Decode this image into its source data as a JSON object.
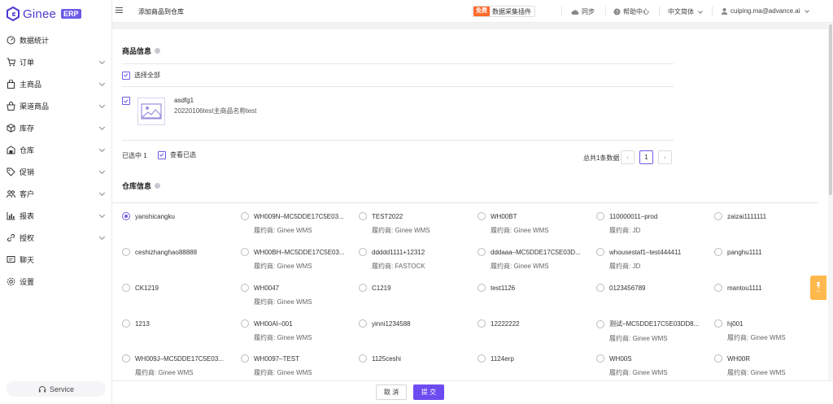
{
  "app": {
    "logo_text": "Ginee",
    "logo_badge": "ERP"
  },
  "sidebar": {
    "items": [
      {
        "label": "数据统计",
        "icon": "dashboard-icon",
        "has_children": false
      },
      {
        "label": "订单",
        "icon": "cart-icon",
        "has_children": true
      },
      {
        "label": "主商品",
        "icon": "bag-icon",
        "has_children": true
      },
      {
        "label": "渠道商品",
        "icon": "store-bag-icon",
        "has_children": true
      },
      {
        "label": "库存",
        "icon": "box-icon",
        "has_children": true
      },
      {
        "label": "仓库",
        "icon": "warehouse-icon",
        "has_children": true
      },
      {
        "label": "促销",
        "icon": "tag-icon",
        "has_children": true
      },
      {
        "label": "客户",
        "icon": "users-icon",
        "has_children": true
      },
      {
        "label": "报表",
        "icon": "bar-chart-icon",
        "has_children": true
      },
      {
        "label": "授权",
        "icon": "link-icon",
        "has_children": true
      },
      {
        "label": "聊天",
        "icon": "chat-icon",
        "has_children": false
      },
      {
        "label": "设置",
        "icon": "gear-icon",
        "has_children": false
      }
    ],
    "service_label": "Service"
  },
  "topbar": {
    "breadcrumb": "添加商品到仓库",
    "plugin_badge": "免费",
    "plugin_label": "数据采集插件",
    "sync": "同步",
    "help": "帮助中心",
    "language": "中文简体",
    "user": "cuiping.ma@advance.ai"
  },
  "product_section": {
    "title": "商品信息",
    "select_all": "选择全部",
    "product": {
      "name": "asdfg1",
      "subtitle": "20220106test主商品名称test"
    },
    "selected_count": "已选中 1",
    "view_selected": "查看已选",
    "total": "总共1条数据",
    "page": "1"
  },
  "warehouse_section": {
    "title": "仓库信息",
    "rows": [
      [
        {
          "name": "yanshicangku",
          "selected": true,
          "provider": ""
        },
        {
          "name": "WH009N–MC5DDE17C5E03...",
          "selected": false,
          "provider": "履约商:  Ginee WMS"
        },
        {
          "name": "TEST2022",
          "selected": false,
          "provider": "履约商:  Ginee WMS"
        },
        {
          "name": "WH00BT",
          "selected": false,
          "provider": "履约商:  Ginee WMS"
        },
        {
          "name": "110000011–prod",
          "selected": false,
          "provider": "履约商:  JD"
        },
        {
          "name": "zaizai1111111",
          "selected": false,
          "provider": ""
        }
      ],
      [
        {
          "name": "ceshizhanghao88888",
          "selected": false,
          "provider": ""
        },
        {
          "name": "WH00BH–MC5DDE17C5E03...",
          "selected": false,
          "provider": "履约商:  Ginee WMS"
        },
        {
          "name": "ddddd1111+12312",
          "selected": false,
          "provider": "履约商:  FASTOCK"
        },
        {
          "name": "dddaaa–MC5DDE17C5E03D...",
          "selected": false,
          "provider": "履约商:  Ginee WMS"
        },
        {
          "name": "whousestaf1–test444411",
          "selected": false,
          "provider": "履约商:  JD"
        },
        {
          "name": "panghu1111",
          "selected": false,
          "provider": ""
        }
      ],
      [
        {
          "name": "CK1219",
          "selected": false,
          "provider": ""
        },
        {
          "name": "WH0047",
          "selected": false,
          "provider": "履约商:  Ginee WMS"
        },
        {
          "name": "C1219",
          "selected": false,
          "provider": ""
        },
        {
          "name": "test1126",
          "selected": false,
          "provider": ""
        },
        {
          "name": "0123456789",
          "selected": false,
          "provider": ""
        },
        {
          "name": "mantou1111",
          "selected": false,
          "provider": ""
        }
      ],
      [
        {
          "name": "1213",
          "selected": false,
          "provider": ""
        },
        {
          "name": "WH00AI–001",
          "selected": false,
          "provider": "履约商:  Ginee WMS"
        },
        {
          "name": "yinni1234588",
          "selected": false,
          "provider": ""
        },
        {
          "name": "12222222",
          "selected": false,
          "provider": ""
        },
        {
          "name": "测试–MC5DDE17C5E03DD8...",
          "selected": false,
          "provider": "履约商:  Ginee WMS"
        },
        {
          "name": "hj001",
          "selected": false,
          "provider": "履约商:  Ginee WMS"
        }
      ],
      [
        {
          "name": "WH009J–MC5DDE17C5E03...",
          "selected": false,
          "provider": "履约商:  Ginee WMS"
        },
        {
          "name": "WH0097–TEST",
          "selected": false,
          "provider": "履约商:  Ginee WMS"
        },
        {
          "name": "1125ceshi",
          "selected": false,
          "provider": ""
        },
        {
          "name": "1124erp",
          "selected": false,
          "provider": ""
        },
        {
          "name": "WH00S",
          "selected": false,
          "provider": "履约商:  Ginee WMS"
        },
        {
          "name": "WH00R",
          "selected": false,
          "provider": "履约商:  Ginee WMS"
        }
      ]
    ]
  },
  "footer": {
    "cancel": "取 消",
    "submit": "提 交"
  },
  "colors": {
    "accent": "#6c5ce7",
    "primary_button": "#6c4cf0",
    "free_badge": "#ff6a2a",
    "float_tab": "#ffb84d"
  }
}
